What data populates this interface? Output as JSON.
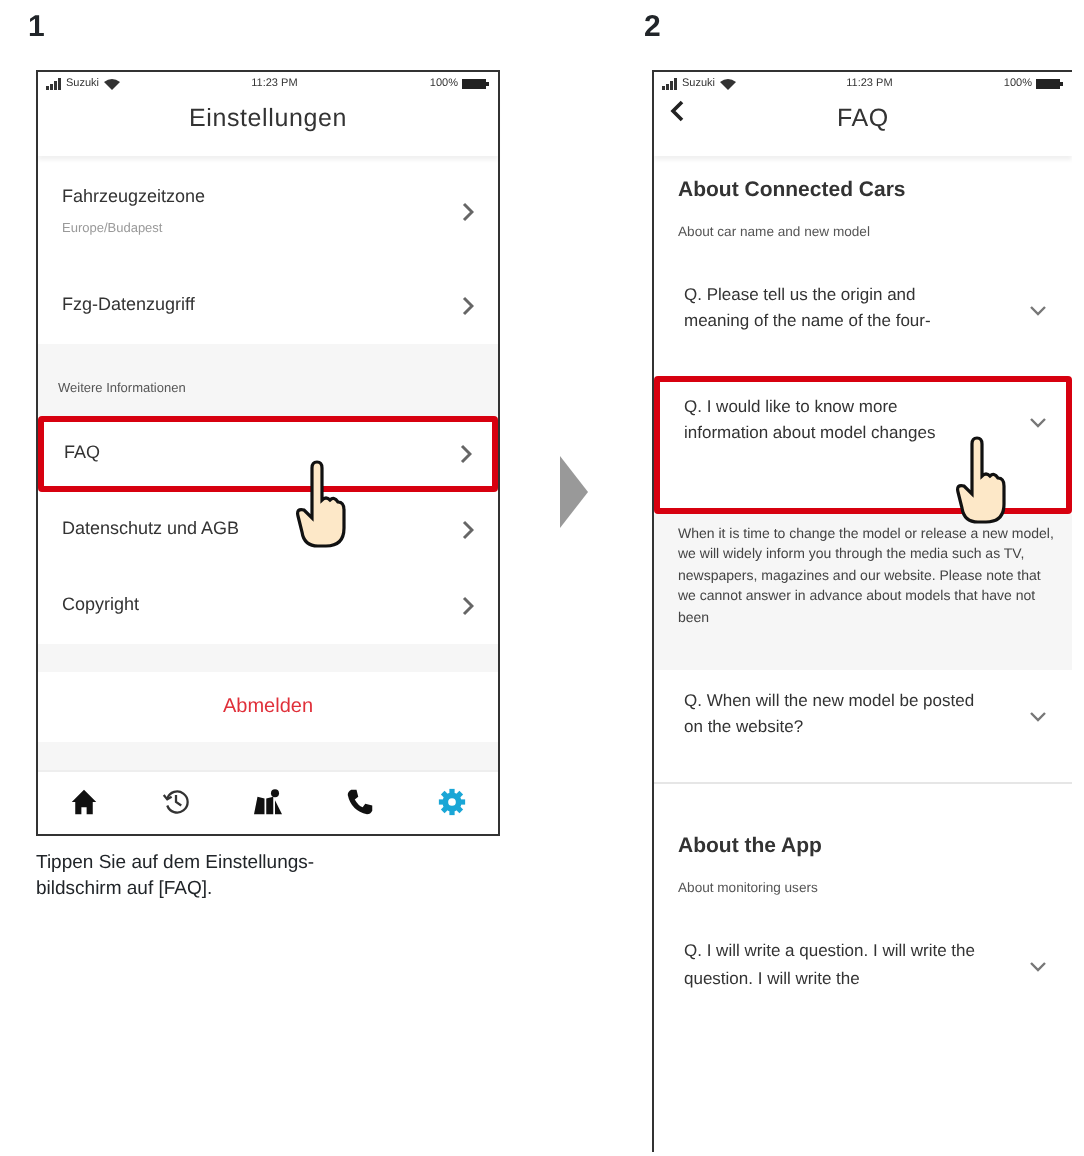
{
  "step_1": {
    "number": "1",
    "screen": {
      "status_bar": {
        "carrier": "Suzuki",
        "time": "11:23 PM",
        "battery": "100%"
      },
      "title": "Einstellungen",
      "rows": [
        {
          "kind": "setting",
          "label": "Fahrzeugzeitzone",
          "value": "Europe/Budapest",
          "highlighted": false
        },
        {
          "kind": "setting",
          "label": "Fzg-Datenzugriff",
          "highlighted": false
        },
        {
          "kind": "header",
          "label": "Weitere Informationen"
        },
        {
          "kind": "setting",
          "label": "FAQ",
          "highlighted": true
        },
        {
          "kind": "setting",
          "label": "Datenschutz und AGB",
          "highlighted": false
        },
        {
          "kind": "setting",
          "label": "Copyright",
          "highlighted": false
        },
        {
          "kind": "action",
          "label": "Abmelden"
        }
      ],
      "tab_bar": [
        {
          "kind": "home",
          "selected": false
        },
        {
          "kind": "history",
          "selected": false
        },
        {
          "kind": "map",
          "selected": false
        },
        {
          "kind": "phone",
          "selected": false
        },
        {
          "kind": "settings",
          "selected": true
        }
      ]
    },
    "caption": "Tippen Sie auf dem Einstellungs-\nbildschirm auf [FAQ]."
  },
  "step_2": {
    "number": "2",
    "screen": {
      "status_bar": {
        "carrier": "Suzuki",
        "time": "11:23 PM",
        "battery": "100%"
      },
      "title": "FAQ",
      "sections": [
        {
          "title": "About Connected Cars",
          "subtitle": "About car name and new model",
          "items": [
            {
              "question": "Q. Please tell us the origin and meaning of the name of the four-",
              "highlighted": false
            },
            {
              "question": "Q. I would like to know more information about model changes",
              "highlighted": true,
              "answer": "When it is time to change the model or release a new model, we will widely inform you through the media such as TV, newspapers, magazines and our website. Please note that we cannot answer in advance about models that have not been"
            },
            {
              "question": "Q. When will the new model be posted on the website?",
              "highlighted": false
            }
          ]
        },
        {
          "title": "About the App",
          "subtitle": "About monitoring users",
          "items": [
            {
              "question": "Q. I will write a question. I will write the question. I will write the",
              "highlighted": false
            }
          ]
        }
      ]
    }
  }
}
